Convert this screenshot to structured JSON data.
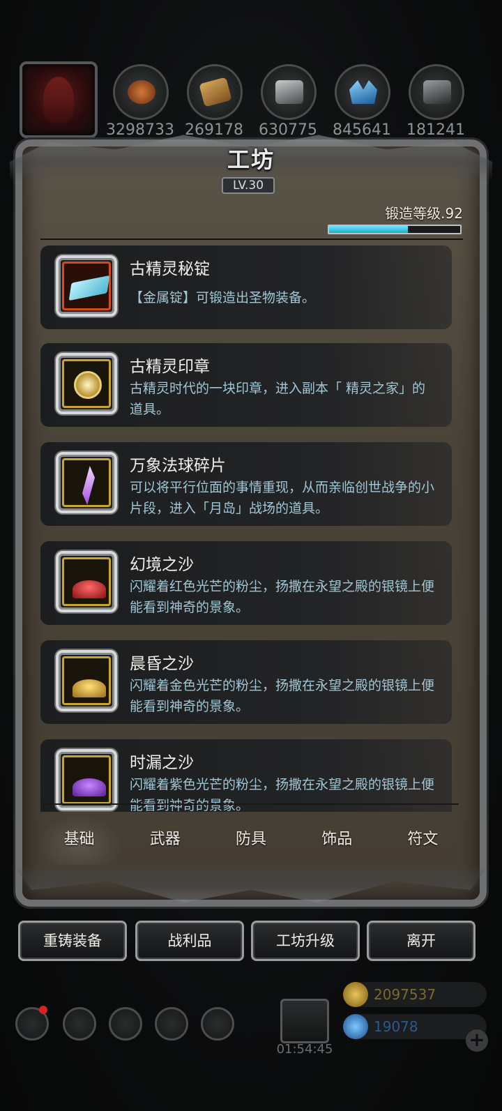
{
  "resources": [
    {
      "name": "helmet",
      "value": "",
      "color": "#7a2220"
    },
    {
      "name": "leather",
      "value": "3298733",
      "color": "#c0622a"
    },
    {
      "name": "wood",
      "value": "269178",
      "color": "#b98a3e"
    },
    {
      "name": "iron",
      "value": "630775",
      "color": "#8b8d8f"
    },
    {
      "name": "crystal",
      "value": "845641",
      "color": "#3d9ee0"
    },
    {
      "name": "ore",
      "value": "181241",
      "color": "#6c6e70"
    }
  ],
  "panel": {
    "title": "工坊",
    "level": "LV.30",
    "forge_label": "锻造等级.92",
    "forge_progress": 0.6
  },
  "items": [
    {
      "name": "古精灵秘锭",
      "desc": "【金属锭】可锻造出圣物装备。",
      "icon": "ingot-icon"
    },
    {
      "name": "古精灵印章",
      "desc": "古精灵时代的一块印章，进入副本「 精灵之家」的道具。",
      "icon": "seal-icon"
    },
    {
      "name": "万象法球碎片",
      "desc": "可以将平行位面的事情重现，从而亲临创世战争的小片段，进入「月岛」战场的道具。",
      "icon": "crystal-shard-icon"
    },
    {
      "name": "幻境之沙",
      "desc": "闪耀着红色光芒的粉尘，扬撒在永望之殿的银镜上便能看到神奇的景象。",
      "icon": "red-sand-icon"
    },
    {
      "name": "晨昏之沙",
      "desc": "闪耀着金色光芒的粉尘，扬撒在永望之殿的银镜上便能看到神奇的景象。",
      "icon": "gold-sand-icon"
    },
    {
      "name": "时漏之沙",
      "desc": "闪耀着紫色光芒的粉尘，扬撒在永望之殿的银镜上便能看到神奇的景象。",
      "icon": "purple-sand-icon"
    }
  ],
  "tabs": [
    "基础",
    "武器",
    "防具",
    "饰品",
    "符文"
  ],
  "active_tab": "基础",
  "actions": [
    "重铸装备",
    "战利品",
    "工坊升级",
    "离开"
  ],
  "hud": {
    "gift_timer": "01:54:45",
    "gold": "2097537",
    "gems": "19078",
    "gold_color": "#7a6a2e",
    "gem_color": "#2a5a8a"
  }
}
